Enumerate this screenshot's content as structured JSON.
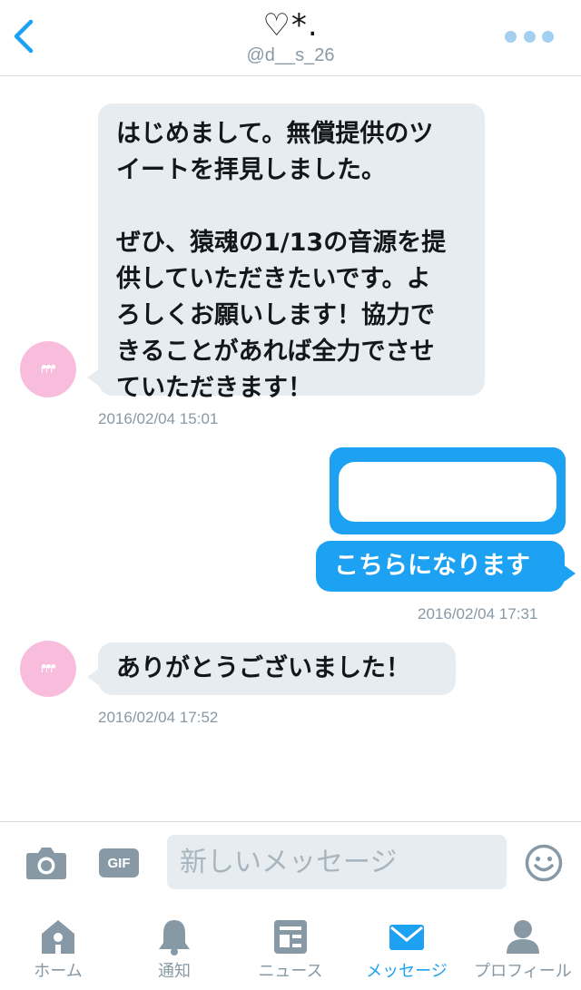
{
  "header": {
    "title": "♡*.",
    "handle": "@d__s_26",
    "back_icon": "chevron-left-icon",
    "more_icon": "more-dots-icon"
  },
  "messages": [
    {
      "direction": "incoming",
      "text": "はじめまして。無償提供のツ\nイートを拝見しました。\n\nぜひ、猿魂の1/13の音源を提\n供していただきたいです。よ\nろしくお願いします！協力で\nきることがあれば全力でさせ\nていただきます！",
      "timestamp": "2016/02/04 15:01"
    },
    {
      "direction": "outgoing",
      "text": "こちらになります",
      "timestamp": "2016/02/04 17:31"
    },
    {
      "direction": "incoming",
      "text": "ありがとうございました！",
      "timestamp": "2016/02/04 17:52"
    }
  ],
  "composer": {
    "placeholder": "新しいメッセージ",
    "gif_label": "GIF",
    "camera_icon": "camera-icon",
    "emoji_icon": "emoji-icon"
  },
  "tabs": [
    {
      "label": "ホーム",
      "icon": "home-icon",
      "active": false
    },
    {
      "label": "通知",
      "icon": "bell-icon",
      "active": false
    },
    {
      "label": "ニュース",
      "icon": "news-icon",
      "active": false
    },
    {
      "label": "メッセージ",
      "icon": "mail-icon",
      "active": true
    },
    {
      "label": "プロフィール",
      "icon": "profile-icon",
      "active": false
    }
  ],
  "colors": {
    "accent": "#1da1f2",
    "incoming_bubble": "#e6ecf0",
    "muted": "#8899a6",
    "avatar": "#f8bcdc"
  }
}
